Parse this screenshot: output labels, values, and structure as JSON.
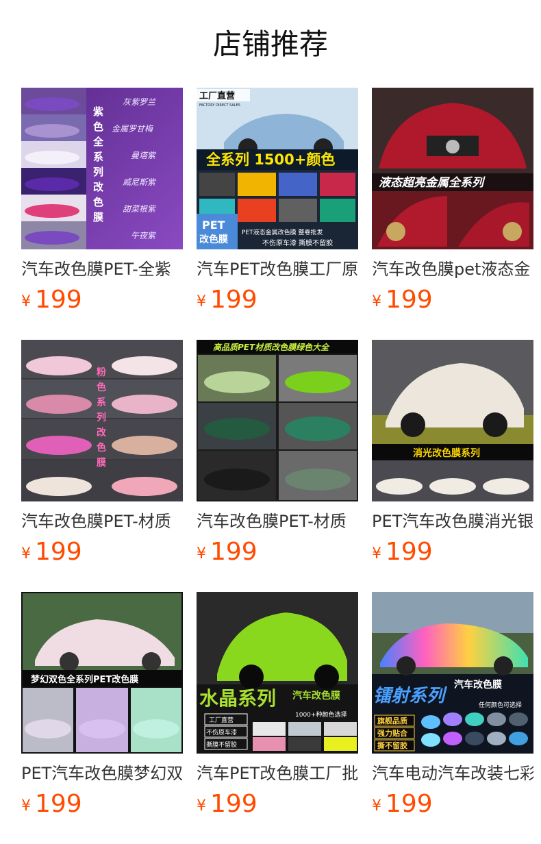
{
  "page": {
    "title": "店铺推荐",
    "accent_color": "#ff4a00"
  },
  "products": [
    {
      "name": "汽车改色膜PET-全紫",
      "currency": "¥",
      "price": "199",
      "image_text": [
        "紫色全系列改色膜",
        "灰紫罗兰",
        "金属罗甘梅",
        "曼塔紫",
        "威尼斯紫",
        "甜菜根紫",
        "午夜紫"
      ]
    },
    {
      "name": "汽车PET改色膜工厂原",
      "currency": "¥",
      "price": "199",
      "image_text": [
        "工厂直营",
        "FACTORY DIRECT SALES",
        "全系列 1500+颜色",
        "PET改色膜",
        "PET液态金属改色膜 整卷批发",
        "不伤原车漆 撕膜不留胶"
      ]
    },
    {
      "name": "汽车改色膜pet液态金",
      "currency": "¥",
      "price": "199",
      "image_text": [
        "液态超亮金属全系列"
      ]
    },
    {
      "name": "汽车改色膜PET-材质",
      "currency": "¥",
      "price": "199",
      "image_text": [
        "粉色系列改色膜"
      ]
    },
    {
      "name": "汽车改色膜PET-材质",
      "currency": "¥",
      "price": "199",
      "image_text": [
        "高品质PET材质改色膜绿色大全"
      ]
    },
    {
      "name": "PET汽车改色膜消光银",
      "currency": "¥",
      "price": "199",
      "image_text": [
        "消光改色膜系列"
      ]
    },
    {
      "name": "PET汽车改色膜梦幻双",
      "currency": "¥",
      "price": "199",
      "image_text": [
        "梦幻双色全系列PET改色膜"
      ]
    },
    {
      "name": "汽车PET改色膜工厂批",
      "currency": "¥",
      "price": "199",
      "image_text": [
        "水晶系列",
        "汽车改色膜",
        "1000+种颜色选择",
        "工厂直营",
        "不伤原车漆",
        "撕膜不留胶"
      ]
    },
    {
      "name": "汽车电动汽车改装七彩",
      "currency": "¥",
      "price": "199",
      "image_text": [
        "镭射系列",
        "汽车改色膜",
        "任何颜色可选择",
        "旗舰品质",
        "强力贴合",
        "撕不留胶"
      ]
    }
  ]
}
